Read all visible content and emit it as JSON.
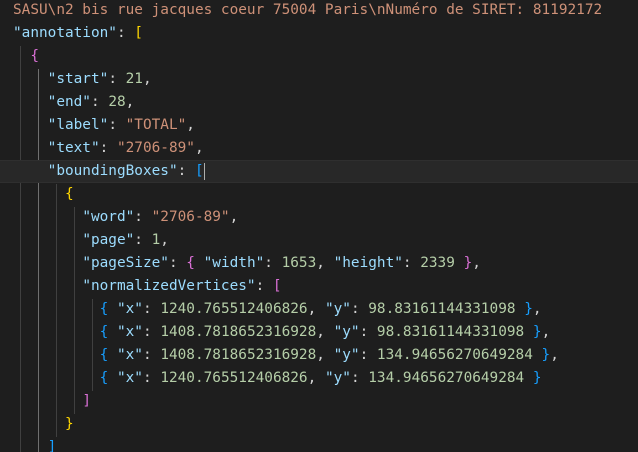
{
  "editor": {
    "lines": [
      [
        {
          "t": "SASU\\n2 bis rue jacques coeur 75004 Paris\\nNuméro de SIRET: 81192172",
          "c": "raw"
        }
      ],
      [
        {
          "t": "\"annotation\"",
          "c": "key"
        },
        {
          "t": ": ",
          "c": "p"
        },
        {
          "t": "[",
          "c": "b1"
        }
      ],
      [
        {
          "t": "  ",
          "c": "p"
        },
        {
          "t": "{",
          "c": "b2"
        }
      ],
      [
        {
          "t": "    ",
          "c": "p"
        },
        {
          "t": "\"start\"",
          "c": "key"
        },
        {
          "t": ": ",
          "c": "p"
        },
        {
          "t": "21",
          "c": "num"
        },
        {
          "t": ",",
          "c": "p"
        }
      ],
      [
        {
          "t": "    ",
          "c": "p"
        },
        {
          "t": "\"end\"",
          "c": "key"
        },
        {
          "t": ": ",
          "c": "p"
        },
        {
          "t": "28",
          "c": "num"
        },
        {
          "t": ",",
          "c": "p"
        }
      ],
      [
        {
          "t": "    ",
          "c": "p"
        },
        {
          "t": "\"label\"",
          "c": "key"
        },
        {
          "t": ": ",
          "c": "p"
        },
        {
          "t": "\"TOTAL\"",
          "c": "str"
        },
        {
          "t": ",",
          "c": "p"
        }
      ],
      [
        {
          "t": "    ",
          "c": "p"
        },
        {
          "t": "\"text\"",
          "c": "key"
        },
        {
          "t": ": ",
          "c": "p"
        },
        {
          "t": "\"2706-89\"",
          "c": "str"
        },
        {
          "t": ",",
          "c": "p"
        }
      ],
      [
        {
          "t": "    ",
          "c": "p"
        },
        {
          "t": "\"boundingBoxes\"",
          "c": "key"
        },
        {
          "t": ": ",
          "c": "p"
        },
        {
          "t": "[",
          "c": "b3"
        },
        {
          "t": "",
          "c": "cursor"
        }
      ],
      [
        {
          "t": "      ",
          "c": "p"
        },
        {
          "t": "{",
          "c": "b1"
        }
      ],
      [
        {
          "t": "        ",
          "c": "p"
        },
        {
          "t": "\"word\"",
          "c": "key"
        },
        {
          "t": ": ",
          "c": "p"
        },
        {
          "t": "\"2706-89\"",
          "c": "str"
        },
        {
          "t": ",",
          "c": "p"
        }
      ],
      [
        {
          "t": "        ",
          "c": "p"
        },
        {
          "t": "\"page\"",
          "c": "key"
        },
        {
          "t": ": ",
          "c": "p"
        },
        {
          "t": "1",
          "c": "num"
        },
        {
          "t": ",",
          "c": "p"
        }
      ],
      [
        {
          "t": "        ",
          "c": "p"
        },
        {
          "t": "\"pageSize\"",
          "c": "key"
        },
        {
          "t": ": ",
          "c": "p"
        },
        {
          "t": "{",
          "c": "b2"
        },
        {
          "t": " ",
          "c": "p"
        },
        {
          "t": "\"width\"",
          "c": "key"
        },
        {
          "t": ": ",
          "c": "p"
        },
        {
          "t": "1653",
          "c": "num"
        },
        {
          "t": ", ",
          "c": "p"
        },
        {
          "t": "\"height\"",
          "c": "key"
        },
        {
          "t": ": ",
          "c": "p"
        },
        {
          "t": "2339",
          "c": "num"
        },
        {
          "t": " ",
          "c": "p"
        },
        {
          "t": "}",
          "c": "b2"
        },
        {
          "t": ",",
          "c": "p"
        }
      ],
      [
        {
          "t": "        ",
          "c": "p"
        },
        {
          "t": "\"normalizedVertices\"",
          "c": "key"
        },
        {
          "t": ": ",
          "c": "p"
        },
        {
          "t": "[",
          "c": "b2"
        }
      ],
      [
        {
          "t": "          ",
          "c": "p"
        },
        {
          "t": "{",
          "c": "b3"
        },
        {
          "t": " ",
          "c": "p"
        },
        {
          "t": "\"x\"",
          "c": "key"
        },
        {
          "t": ": ",
          "c": "p"
        },
        {
          "t": "1240.765512406826",
          "c": "num"
        },
        {
          "t": ", ",
          "c": "p"
        },
        {
          "t": "\"y\"",
          "c": "key"
        },
        {
          "t": ": ",
          "c": "p"
        },
        {
          "t": "98.83161144331098",
          "c": "num"
        },
        {
          "t": " ",
          "c": "p"
        },
        {
          "t": "}",
          "c": "b3"
        },
        {
          "t": ",",
          "c": "p"
        }
      ],
      [
        {
          "t": "          ",
          "c": "p"
        },
        {
          "t": "{",
          "c": "b3"
        },
        {
          "t": " ",
          "c": "p"
        },
        {
          "t": "\"x\"",
          "c": "key"
        },
        {
          "t": ": ",
          "c": "p"
        },
        {
          "t": "1408.7818652316928",
          "c": "num"
        },
        {
          "t": ", ",
          "c": "p"
        },
        {
          "t": "\"y\"",
          "c": "key"
        },
        {
          "t": ": ",
          "c": "p"
        },
        {
          "t": "98.83161144331098",
          "c": "num"
        },
        {
          "t": " ",
          "c": "p"
        },
        {
          "t": "}",
          "c": "b3"
        },
        {
          "t": ",",
          "c": "p"
        }
      ],
      [
        {
          "t": "          ",
          "c": "p"
        },
        {
          "t": "{",
          "c": "b3"
        },
        {
          "t": " ",
          "c": "p"
        },
        {
          "t": "\"x\"",
          "c": "key"
        },
        {
          "t": ": ",
          "c": "p"
        },
        {
          "t": "1408.7818652316928",
          "c": "num"
        },
        {
          "t": ", ",
          "c": "p"
        },
        {
          "t": "\"y\"",
          "c": "key"
        },
        {
          "t": ": ",
          "c": "p"
        },
        {
          "t": "134.94656270649284",
          "c": "num"
        },
        {
          "t": " ",
          "c": "p"
        },
        {
          "t": "}",
          "c": "b3"
        },
        {
          "t": ",",
          "c": "p"
        }
      ],
      [
        {
          "t": "          ",
          "c": "p"
        },
        {
          "t": "{",
          "c": "b3"
        },
        {
          "t": " ",
          "c": "p"
        },
        {
          "t": "\"x\"",
          "c": "key"
        },
        {
          "t": ": ",
          "c": "p"
        },
        {
          "t": "1240.765512406826",
          "c": "num"
        },
        {
          "t": ", ",
          "c": "p"
        },
        {
          "t": "\"y\"",
          "c": "key"
        },
        {
          "t": ": ",
          "c": "p"
        },
        {
          "t": "134.94656270649284",
          "c": "num"
        },
        {
          "t": " ",
          "c": "p"
        },
        {
          "t": "}",
          "c": "b3"
        }
      ],
      [
        {
          "t": "        ",
          "c": "p"
        },
        {
          "t": "]",
          "c": "b2"
        }
      ],
      [
        {
          "t": "      ",
          "c": "p"
        },
        {
          "t": "}",
          "c": "b1"
        }
      ],
      [
        {
          "t": "    ",
          "c": "p"
        },
        {
          "t": "]",
          "c": "b3"
        }
      ]
    ],
    "current_line": 7
  },
  "colors": {
    "background": "#1e1e1e",
    "key": "#9cdcfe",
    "string": "#ce9178",
    "number": "#b5cea8",
    "bracket_gold": "#ffd700",
    "bracket_orchid": "#da70d6",
    "bracket_blue": "#179fff"
  }
}
